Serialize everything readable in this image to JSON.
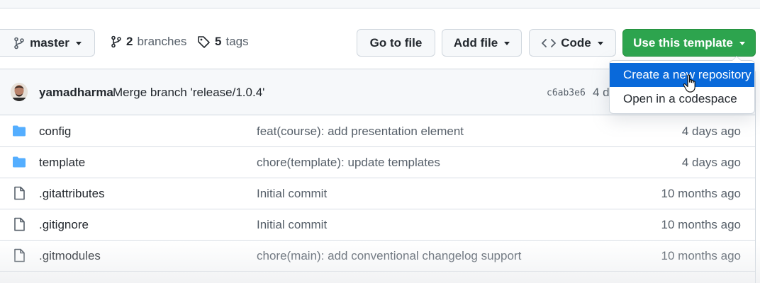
{
  "toolbar": {
    "branch_name": "master",
    "branches_count": "2",
    "branches_label": "branches",
    "tags_count": "5",
    "tags_label": "tags",
    "go_to_file": "Go to file",
    "add_file": "Add file",
    "code": "Code",
    "use_template": "Use this template"
  },
  "template_menu": {
    "items": [
      {
        "label": "Create a new repository",
        "state": "highlighted"
      },
      {
        "label": "Open in a codespace"
      }
    ]
  },
  "latest_commit": {
    "author": "yamadharma",
    "message": "Merge branch 'release/1.0.4'",
    "sha": "c6ab3e6",
    "age": "4 d"
  },
  "files": [
    {
      "name": "config",
      "type": "folder",
      "message": "feat(course): add presentation element",
      "age": "4 days ago"
    },
    {
      "name": "template",
      "type": "folder",
      "message": "chore(template): update templates",
      "age": "4 days ago"
    },
    {
      "name": ".gitattributes",
      "type": "file",
      "message": "Initial commit",
      "age": "10 months ago"
    },
    {
      "name": ".gitignore",
      "type": "file",
      "message": "Initial commit",
      "age": "10 months ago"
    },
    {
      "name": ".gitmodules",
      "type": "file",
      "message": "chore(main): add conventional changelog support",
      "age": "10 months ago"
    }
  ],
  "colors": {
    "primary_green": "#2da44e",
    "menu_highlight": "#0969da",
    "folder_icon": "#54aeff",
    "muted_text": "#57606a"
  },
  "icons": [
    "git-branch-icon",
    "tag-icon",
    "code-icon",
    "folder-icon",
    "file-icon",
    "hand-cursor-icon"
  ]
}
